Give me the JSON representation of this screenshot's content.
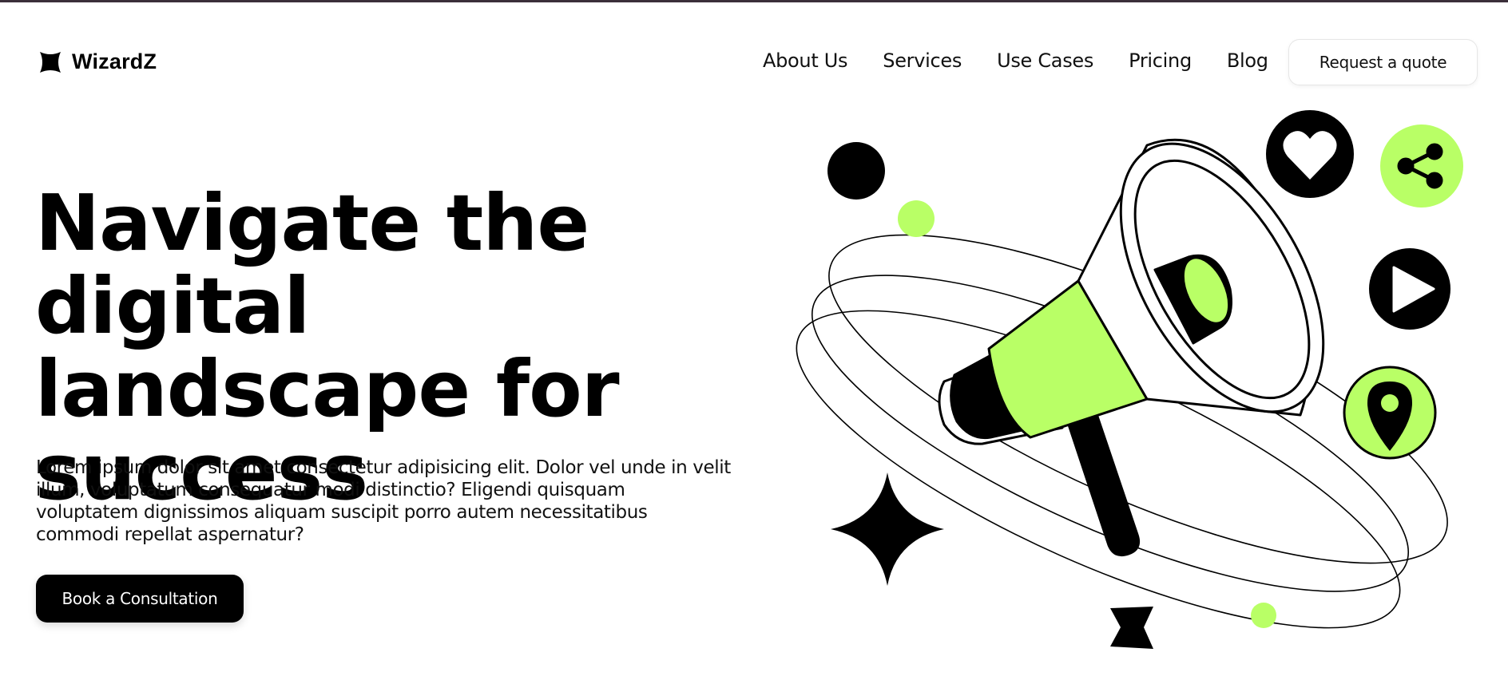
{
  "brand": {
    "name": "WizardZ",
    "icon": "star-logo-icon"
  },
  "nav": {
    "links": [
      {
        "label": "About Us"
      },
      {
        "label": "Services"
      },
      {
        "label": "Use Cases"
      },
      {
        "label": "Pricing"
      },
      {
        "label": "Blog"
      }
    ],
    "cta_label": "Request a quote"
  },
  "hero": {
    "title_lines": [
      "Navigate the digital",
      "landscape for",
      "success"
    ],
    "description": "Lorem ipsum dolor sit amet consectetur adipisicing elit. Dolor vel unde in velit illum, voluptatum consequatur modi distinctio? Eligendi quisquam voluptatem dignissimos aliquam suscipit porro autem necessitatibus commodi repellat aspernatur?",
    "button_label": "Book a Consultation"
  },
  "illustration": {
    "icons": [
      "megaphone-icon",
      "heart-icon",
      "share-icon",
      "play-icon",
      "location-pin-icon",
      "four-point-star-icon"
    ]
  },
  "colors": {
    "accent": "#b9ff66",
    "dark": "#000000",
    "background": "#ffffff"
  }
}
